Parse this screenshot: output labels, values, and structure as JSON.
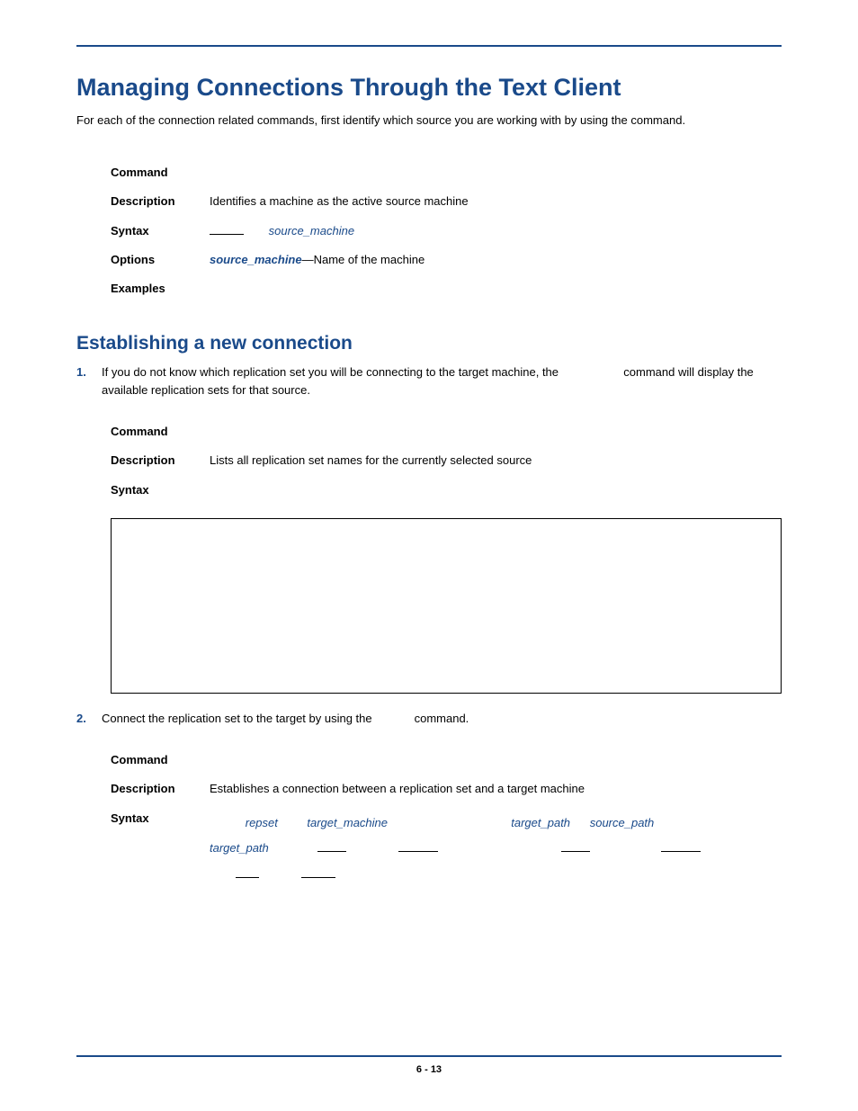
{
  "title": "Managing Connections Through the Text Client",
  "intro": "For each of the connection related commands, first identify which source you are working with by using the command.",
  "table1": {
    "command_label": "Command",
    "description_label": "Description",
    "description_value": "Identifies a machine as the active source machine",
    "syntax_label": "Syntax",
    "syntax_param": "source_machine",
    "options_label": "Options",
    "options_param": "source_machine",
    "options_sep": "—",
    "options_desc": "Name of the machine",
    "examples_label": "Examples"
  },
  "section2_title": "Establishing a new connection",
  "step1": {
    "num": "1.",
    "text_a": "If you do not know which replication set you will be connecting to the target machine, the ",
    "text_b": " command will display the available replication sets for that source."
  },
  "table2": {
    "command_label": "Command",
    "description_label": "Description",
    "description_value": "Lists all replication set names for the currently selected source",
    "syntax_label": "Syntax"
  },
  "step2": {
    "num": "2.",
    "text_a": "Connect the replication set to the target by using the ",
    "text_b": " command."
  },
  "table3": {
    "command_label": "Command",
    "description_label": "Description",
    "description_value": "Establishes a connection between a replication set and a target machine",
    "syntax_label": "Syntax",
    "p_repset": "repset",
    "p_target_machine": "target_machine",
    "p_target_path": "target_path",
    "p_source_path": "source_path",
    "p_target_path2": "target_path"
  },
  "page_number": "6 - 13"
}
